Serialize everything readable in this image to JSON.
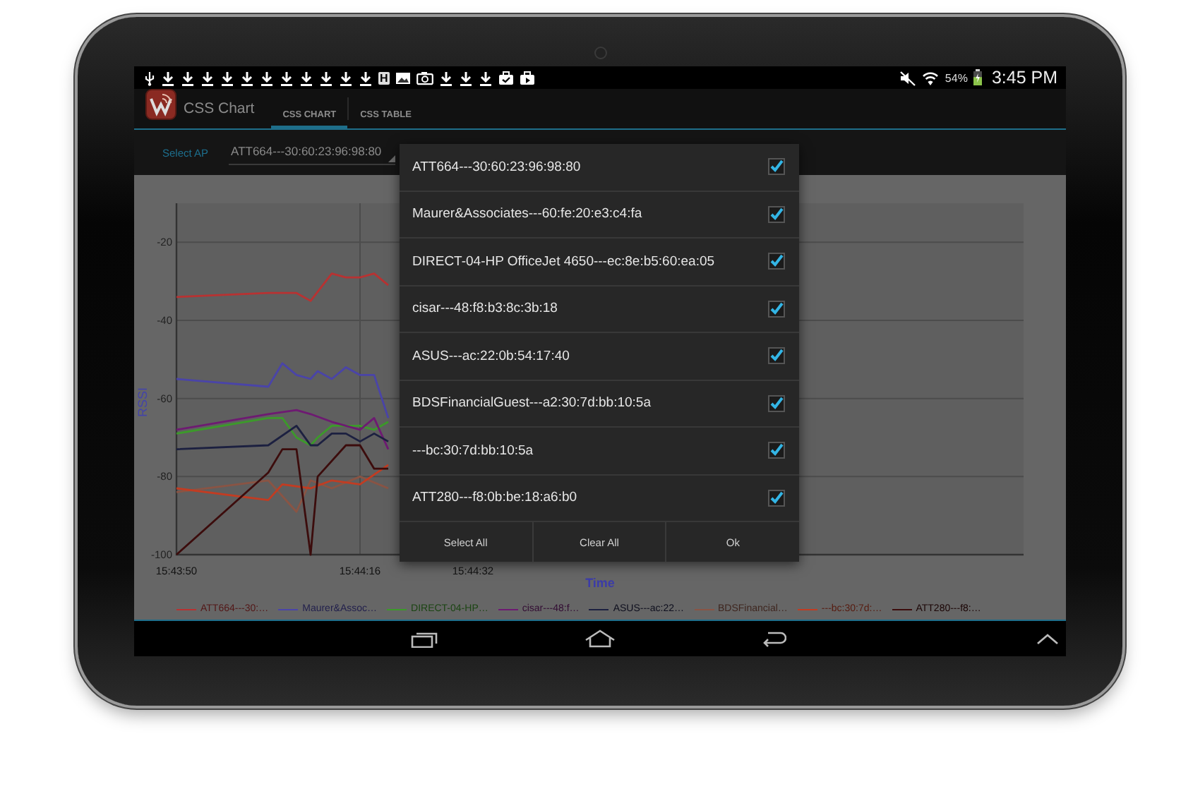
{
  "status_bar": {
    "notification_badge": "H",
    "battery": "54%",
    "time": "3:45 PM"
  },
  "action_bar": {
    "app_title": "CSS Chart",
    "tabs": [
      {
        "label": "CSS CHART",
        "selected": true
      },
      {
        "label": "CSS TABLE",
        "selected": false
      }
    ]
  },
  "ap_selector": {
    "label": "Select AP",
    "value": "ATT664---30:60:23:96:98:80"
  },
  "chart": {
    "chart_data": {
      "type": "line",
      "xlabel": "Time",
      "ylabel": "RSSI",
      "grid": true,
      "legend": "bottom",
      "xlim": [
        56630,
        56750
      ],
      "ylim": [
        -100,
        -10
      ],
      "xticks": [
        {
          "value": 56630,
          "label": "15:43:50"
        },
        {
          "value": 56656,
          "label": "15:44:16"
        },
        {
          "value": 56672,
          "label": "15:44:32"
        }
      ],
      "yticks": [
        -100,
        -80,
        -60,
        -40,
        -20
      ],
      "series": [
        {
          "name": "ATT664---30:…",
          "color": "#b83232",
          "x": [
            56630,
            56643,
            56647,
            56649,
            56652,
            56654,
            56656,
            56658,
            56660
          ],
          "values": [
            -34,
            -33,
            -33,
            -35,
            -28,
            -29,
            -29,
            -28,
            -31
          ]
        },
        {
          "name": "Maurer&Assoc…",
          "color": "#4a44a8",
          "x": [
            56630,
            56643,
            56645,
            56647,
            56649,
            56650,
            56652,
            56654,
            56656,
            56658,
            56660
          ],
          "values": [
            -55,
            -57,
            -51,
            -54,
            -55,
            -53,
            -55,
            -52,
            -54,
            -54,
            -65
          ]
        },
        {
          "name": "DIRECT-04-HP…",
          "color": "#3c9a2a",
          "x": [
            56630,
            56643,
            56645,
            56647,
            56649,
            56650,
            56652,
            56654,
            56656,
            56658,
            56660
          ],
          "values": [
            -69,
            -65,
            -65,
            -70,
            -72,
            -70,
            -67,
            -67,
            -67,
            -68,
            -66
          ]
        },
        {
          "name": "cisar---48:f…",
          "color": "#6e1a72",
          "x": [
            56630,
            56643,
            56647,
            56649,
            56652,
            56656,
            56658,
            56660
          ],
          "values": [
            -68,
            -64,
            -63,
            -64,
            -66,
            -68,
            -65,
            -73
          ]
        },
        {
          "name": "ASUS---ac:22…",
          "color": "#1c2040",
          "x": [
            56630,
            56643,
            56647,
            56649,
            56650,
            56652,
            56654,
            56656,
            56658,
            56660
          ],
          "values": [
            -73,
            -72,
            -67,
            -72,
            -72,
            -69,
            -69,
            -71,
            -69,
            -71
          ]
        },
        {
          "name": "BDSFinancial…",
          "color": "#8a5444",
          "x": [
            56630,
            56643,
            56647,
            56649,
            56652,
            56656,
            56660
          ],
          "values": [
            -84,
            -81,
            -89,
            -81,
            -83,
            -80,
            -83
          ]
        },
        {
          "name": "---bc:30:7d:…",
          "color": "#c23c22",
          "x": [
            56630,
            56643,
            56645,
            56649,
            56652,
            56656,
            56660
          ],
          "values": [
            -83,
            -86,
            -82,
            -83,
            -81,
            -82,
            -77
          ]
        },
        {
          "name": "ATT280---f8:…",
          "color": "#3c0c0c",
          "x": [
            56630,
            56643,
            56645,
            56647,
            56649,
            56650,
            56654,
            56656,
            56658,
            56660
          ],
          "values": [
            -100,
            -79,
            -73,
            -73,
            -100,
            -80,
            -72,
            -72,
            -78,
            -78
          ]
        }
      ]
    }
  },
  "dialog": {
    "items": [
      {
        "label": "ATT664---30:60:23:96:98:80",
        "checked": true
      },
      {
        "label": "Maurer&Associates---60:fe:20:e3:c4:fa",
        "checked": true
      },
      {
        "label": "DIRECT-04-HP OfficeJet 4650---ec:8e:b5:60:ea:05",
        "checked": true
      },
      {
        "label": "cisar---48:f8:b3:8c:3b:18",
        "checked": true
      },
      {
        "label": "ASUS---ac:22:0b:54:17:40",
        "checked": true
      },
      {
        "label": "BDSFinancialGuest---a2:30:7d:bb:10:5a",
        "checked": true
      },
      {
        "label": "---bc:30:7d:bb:10:5a",
        "checked": true
      },
      {
        "label": "ATT280---f8:0b:be:18:a6:b0",
        "checked": true
      }
    ],
    "buttons": [
      "Select All",
      "Clear All",
      "Ok"
    ]
  }
}
